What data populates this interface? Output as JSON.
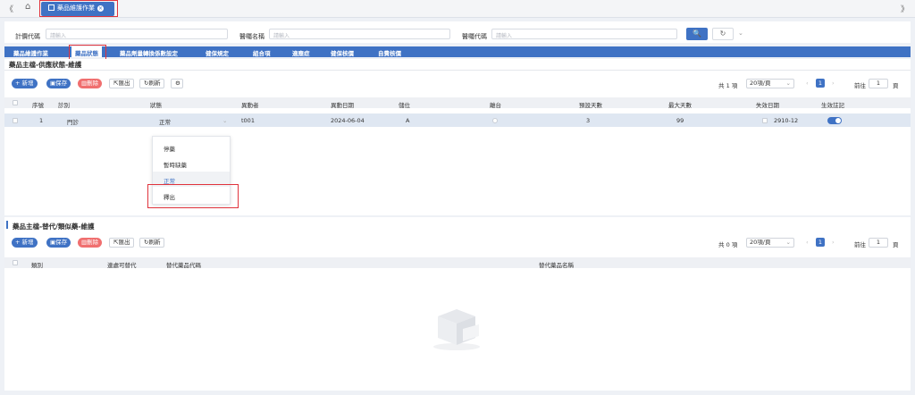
{
  "topbar": {
    "nav_left": "《",
    "nav_right": "》",
    "tab_label": "藥品維護作業",
    "tab_close": "×"
  },
  "filters": [
    {
      "label": "計價代碼",
      "placeholder": "請輸入"
    },
    {
      "label": "醫囑名稱",
      "placeholder": "請輸入"
    },
    {
      "label": "醫囑代碼",
      "placeholder": "請輸入"
    }
  ],
  "search_icon": "🔍",
  "reset_icon": "↻",
  "subtabs": [
    "藥品維護作業",
    "藥品狀態",
    "藥品劑量轉換係數設定",
    "健保規定",
    "組合項",
    "適應症",
    "健保核價",
    "自費核價"
  ],
  "section1": {
    "title": "藥品主檔-供應狀態-維護",
    "buttons": {
      "add": "+ 新增",
      "save": "保存",
      "delete": "刪除",
      "export": "匯出",
      "refresh": "刷新",
      "settings": "⚙"
    },
    "pager": {
      "total": "共 1 項",
      "page_size": "20項/頁",
      "current": "1",
      "goto": "前往",
      "goto_value": "1",
      "page_unit": "頁"
    },
    "columns": [
      "序號",
      "診別",
      "狀態",
      "異動者",
      "異動日期",
      "儲位",
      "離台",
      "預設天數",
      "最大天數",
      "失效日期",
      "生效註記"
    ],
    "rows": [
      {
        "seq": "1",
        "clinic": "門診",
        "status": "正常",
        "modifier": "t001",
        "date": "2024-06-04",
        "location": "A",
        "default_days": "3",
        "max_days": "99",
        "expiry": "2910-12"
      }
    ],
    "dropdown_options": [
      "停藥",
      "暫時缺藥",
      "正常",
      "釋出"
    ],
    "dropdown_selected": "正常"
  },
  "section2": {
    "title": "藥品主檔-替代/類似藥-維護",
    "buttons": {
      "add": "+ 新增",
      "save": "保存",
      "delete": "刪除",
      "export": "匯出",
      "refresh": "刷新"
    },
    "pager": {
      "total": "共 0 項",
      "page_size": "20項/頁",
      "current": "1",
      "goto": "前往",
      "goto_value": "1",
      "page_unit": "頁"
    },
    "columns": [
      "類別",
      "連處可替代",
      "替代藥品代碼",
      "替代藥品名稱"
    ]
  },
  "colors": {
    "primary": "#3f72c4",
    "danger": "#f06f6f",
    "highlight": "#e0333c"
  }
}
